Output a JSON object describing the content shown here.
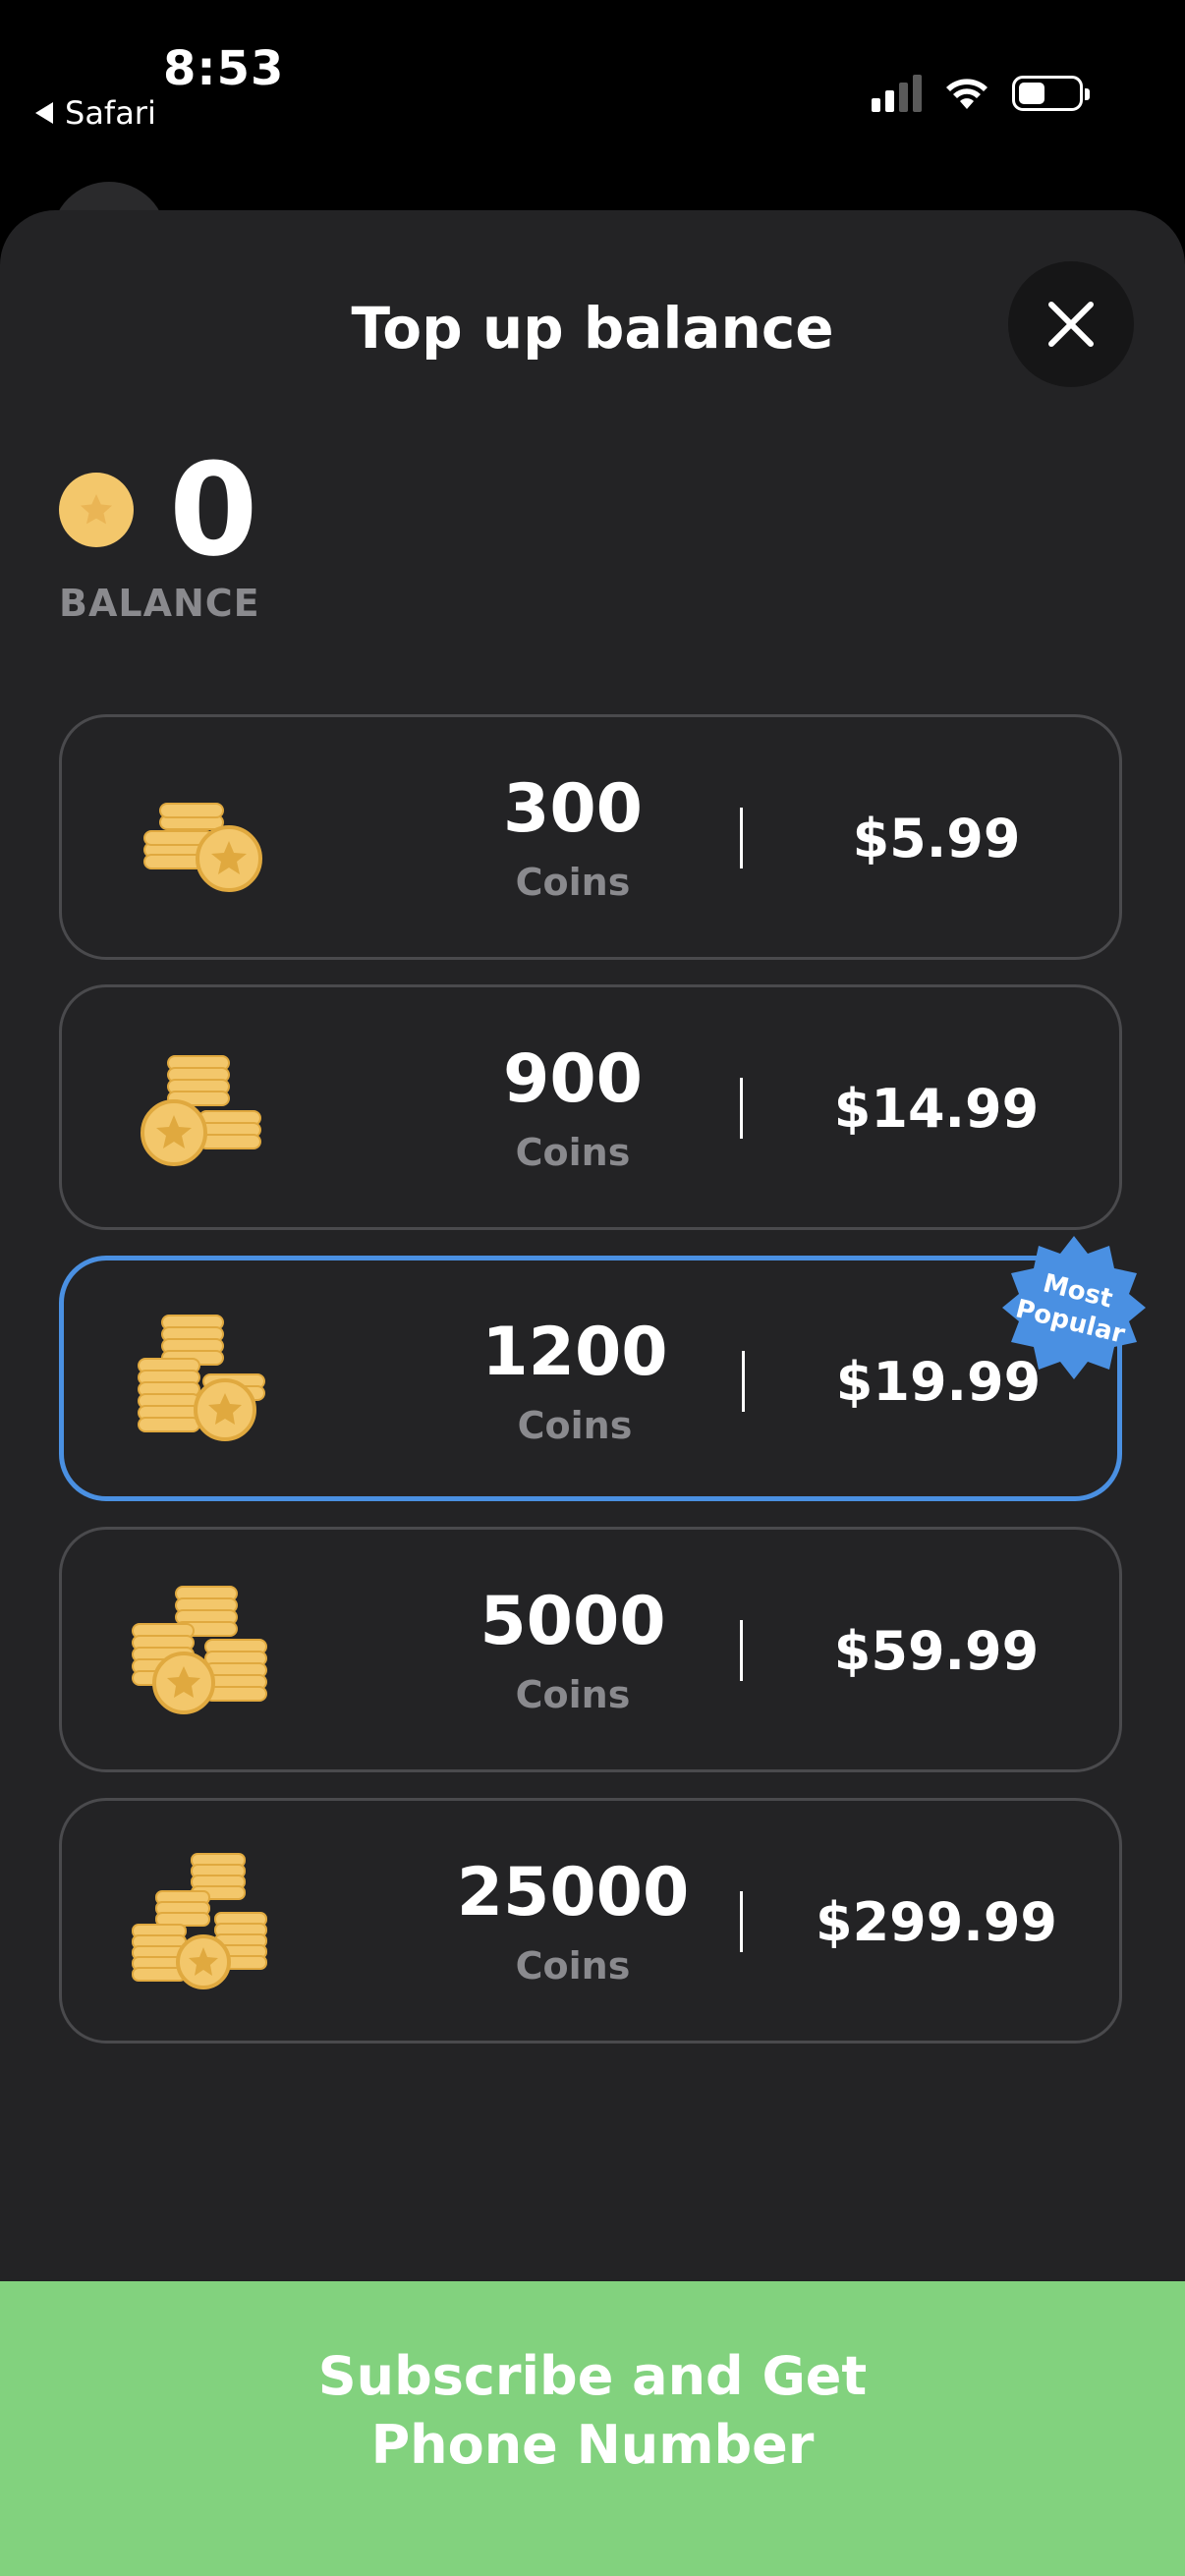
{
  "status_bar": {
    "time": "8:53",
    "back_app": "Safari"
  },
  "sheet": {
    "title": "Top up balance",
    "balance": {
      "value": "0",
      "label": "BALANCE"
    }
  },
  "packages": [
    {
      "amount": "300",
      "unit": "Coins",
      "price": "$5.99"
    },
    {
      "amount": "900",
      "unit": "Coins",
      "price": "$14.99"
    },
    {
      "amount": "1200",
      "unit": "Coins",
      "price": "$19.99",
      "selected": true
    },
    {
      "amount": "5000",
      "unit": "Coins",
      "price": "$59.99"
    },
    {
      "amount": "25000",
      "unit": "Coins",
      "price": "$299.99"
    }
  ],
  "badge": {
    "text": "Most Popular"
  },
  "cta": {
    "label": "Subscribe and Get\nPhone Number"
  },
  "colors": {
    "accent_blue": "#4a90e2",
    "cta_green": "#82d27e",
    "coin_gold": "#f3c76b",
    "sheet_bg": "#232325"
  }
}
